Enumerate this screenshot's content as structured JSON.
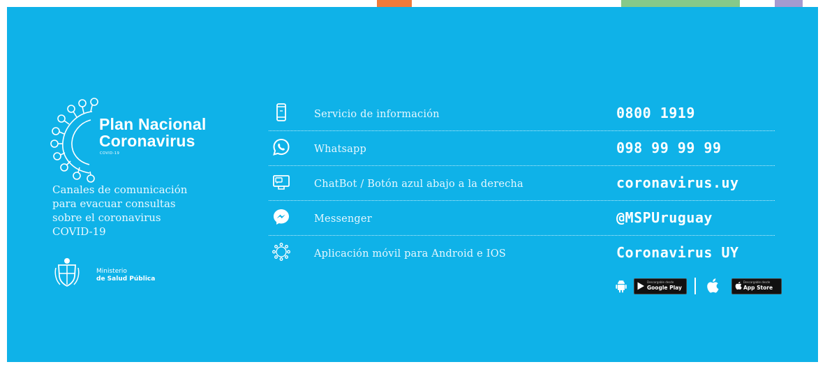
{
  "colors": {
    "background": "#0fb2e8",
    "text": "#ffffff",
    "stripe_orange": "#f07a3a",
    "stripe_green": "#86c98a",
    "stripe_purple": "#a59ad0"
  },
  "brand": {
    "title_line1": "Plan Nacional",
    "title_line2": "Coronavirus",
    "subtitle": "COVID-19",
    "icon": "virus-outline-icon"
  },
  "channels_text": [
    "Canales de comunicación",
    "para evacuar consultas",
    "sobre el coronavirus",
    "COVID-19"
  ],
  "ministry": {
    "line1": "Ministerio",
    "line2": "de Salud Pública",
    "icon": "coat-of-arms-icon"
  },
  "contacts": [
    {
      "icon": "phone-icon",
      "label": "Servicio de información",
      "value": "0800 1919"
    },
    {
      "icon": "whatsapp-icon",
      "label": "Whatsapp",
      "value": "098 99 99 99"
    },
    {
      "icon": "chat-monitor-icon",
      "label": "ChatBot / Botón azul abajo a la derecha",
      "value": "coronavirus.uy"
    },
    {
      "icon": "messenger-icon",
      "label": "Messenger",
      "value": "@MSPUruguay"
    },
    {
      "icon": "app-virus-icon",
      "label": "Aplicación móvil para Android e IOS",
      "value": "Coronavirus UY"
    }
  ],
  "stores": {
    "google_play": {
      "small": "Descargable desde",
      "main": "Google Play"
    },
    "app_store": {
      "small": "Descargable desde",
      "main": "App Store"
    }
  }
}
